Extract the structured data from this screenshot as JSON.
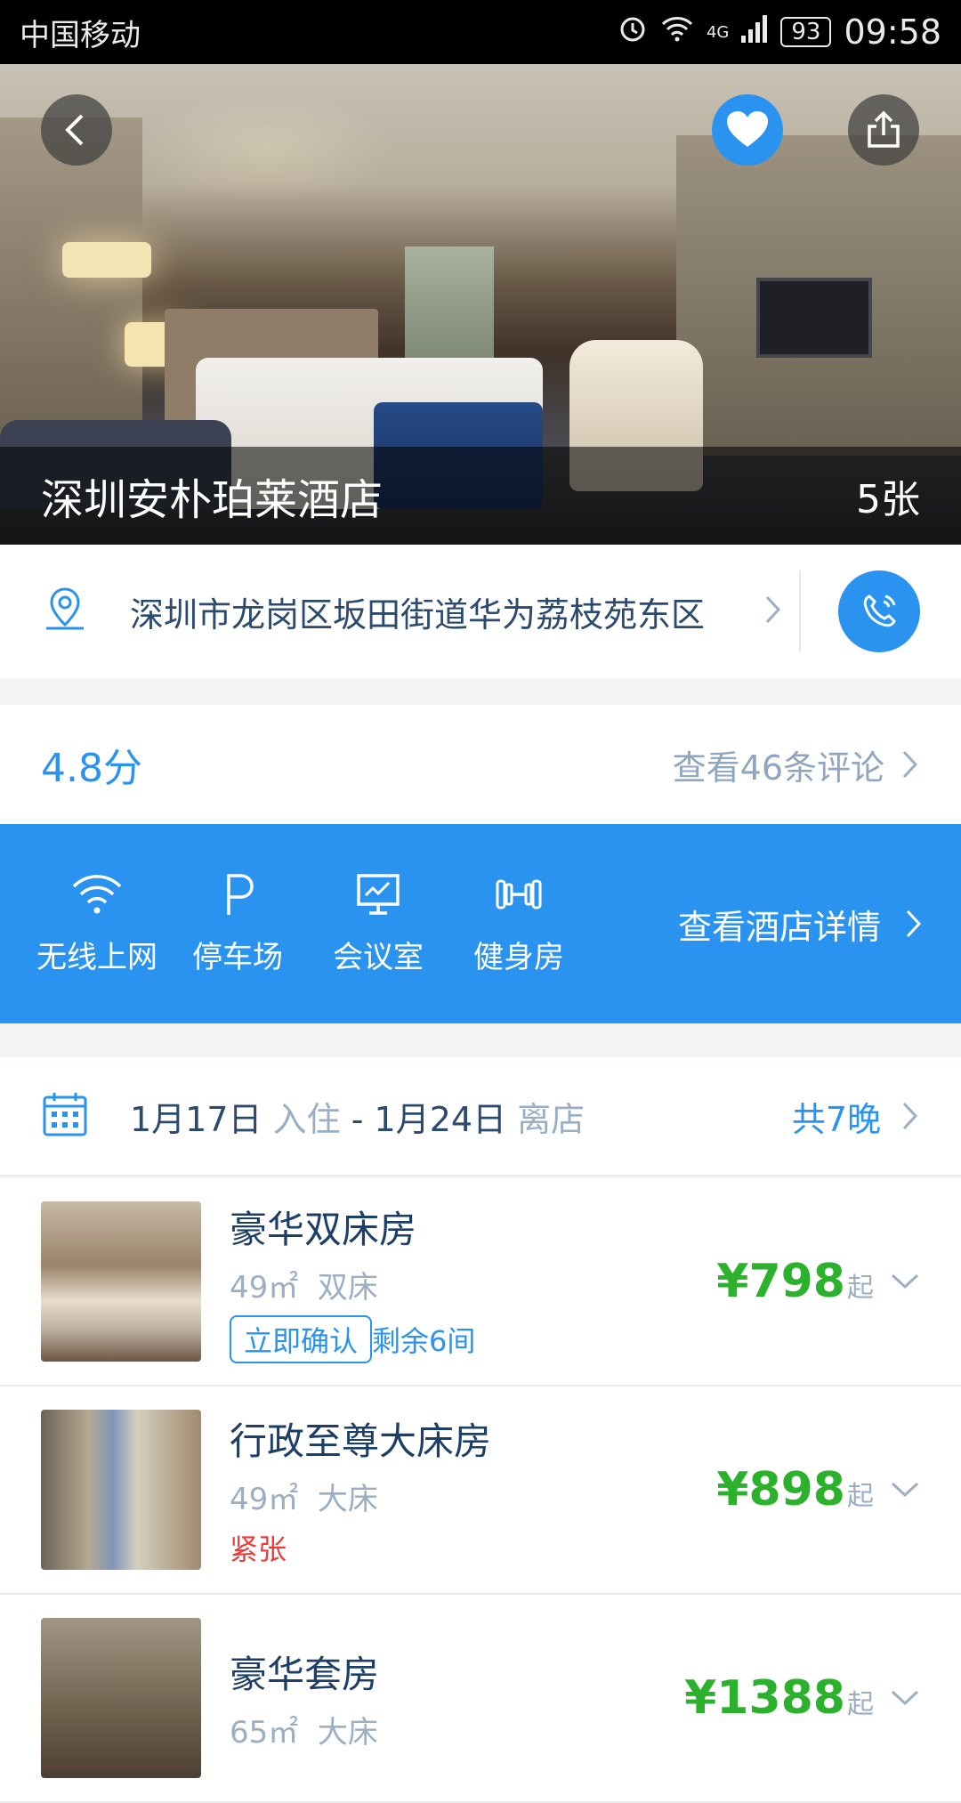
{
  "status_bar": {
    "carrier": "中国移动",
    "network": "4G",
    "battery": "93",
    "time": "09:58"
  },
  "hero": {
    "hotel_name": "深圳安朴珀莱酒店",
    "photo_count": "5张"
  },
  "address": {
    "text": "深圳市龙岗区坂田街道华为荔枝苑东区"
  },
  "rating": {
    "score": "4.8分",
    "reviews_link": "查看46条评论"
  },
  "amenities": {
    "items": [
      {
        "label": "无线上网",
        "icon": "wifi-icon"
      },
      {
        "label": "停车场",
        "icon": "parking-icon"
      },
      {
        "label": "会议室",
        "icon": "meeting-room-icon"
      },
      {
        "label": "健身房",
        "icon": "gym-icon"
      }
    ],
    "details_link": "查看酒店详情"
  },
  "stay": {
    "checkin_date": "1月17日",
    "checkin_label": "入住",
    "separator": "-",
    "checkout_date": "1月24日",
    "checkout_label": "离店",
    "nights": "共7晚"
  },
  "rooms": [
    {
      "name": "豪华双床房",
      "size": "49㎡",
      "bed": "双床",
      "tag_confirm": "立即确认",
      "remaining": "剩余6间",
      "price": "¥798",
      "price_suffix": "起"
    },
    {
      "name": "行政至尊大床房",
      "size": "49㎡",
      "bed": "大床",
      "status": "紧张",
      "price": "¥898",
      "price_suffix": "起"
    },
    {
      "name": "豪华套房",
      "size": "65㎡",
      "bed": "大床",
      "price": "¥1388",
      "price_suffix": "起"
    }
  ],
  "colors": {
    "accent": "#2a93f0",
    "price": "#2cb12c",
    "warning": "#ee3a3a",
    "status_bar": "#000000"
  }
}
